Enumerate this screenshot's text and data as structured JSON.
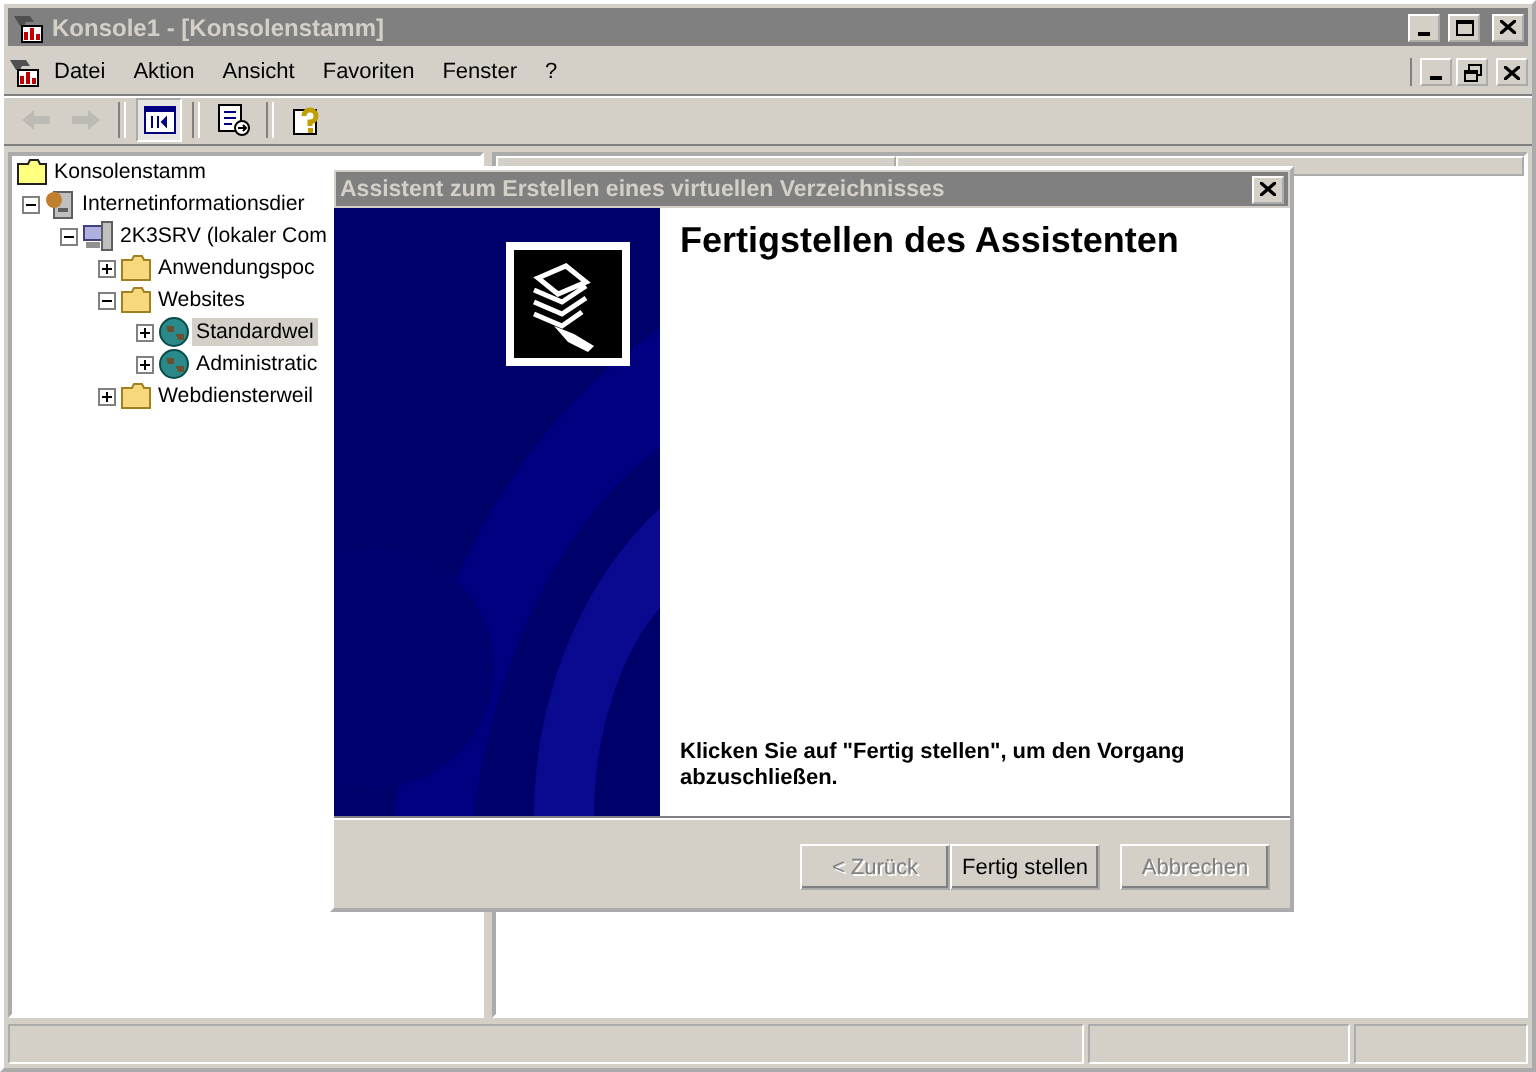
{
  "window": {
    "title": "Konsole1 - [Konsolenstamm]"
  },
  "menu": [
    "Datei",
    "Aktion",
    "Ansicht",
    "Favoriten",
    "Fenster",
    "?"
  ],
  "toolbar": [
    {
      "disabled": true,
      "pressed": false
    },
    {
      "disabled": true,
      "pressed": false
    },
    {
      "disabled": false,
      "pressed": true
    },
    {
      "disabled": false,
      "pressed": false
    },
    {
      "disabled": false,
      "pressed": false
    }
  ],
  "tree": {
    "label": "Konsolenstamm",
    "children": [
      {
        "label": "Internetinformationsdier",
        "kind": "iis",
        "expanded": true,
        "selected": false,
        "children": [
          {
            "label": "2K3SRV (lokaler Com",
            "kind": "computer",
            "expanded": true,
            "selected": false,
            "children": [
              {
                "label": "Anwendungspoc",
                "kind": "folder",
                "expanded": false,
                "selected": false
              },
              {
                "label": "Websites",
                "kind": "folder",
                "expanded": true,
                "selected": false,
                "children": [
                  {
                    "label": "Standardwel",
                    "kind": "globe",
                    "expanded": false,
                    "selected": true
                  },
                  {
                    "label": "Administratic",
                    "kind": "globe",
                    "expanded": false,
                    "selected": false
                  }
                ]
              },
              {
                "label": "Webdiensterweil",
                "kind": "folder",
                "expanded": false,
                "selected": false
              }
            ]
          }
        ]
      }
    ]
  },
  "dialog": {
    "title": "Assistent zum Erstellen eines virtuellen Verzeichnisses",
    "heading": "Fertigstellen des Assistenten",
    "message": "Klicken Sie auf \"Fertig stellen\", um den Vorgang abzuschließen.",
    "buttons": [
      {
        "label": "< Zurück",
        "disabled": true
      },
      {
        "label": "Fertig stellen",
        "disabled": false
      },
      {
        "label": "Abbrechen",
        "disabled": true
      }
    ]
  }
}
